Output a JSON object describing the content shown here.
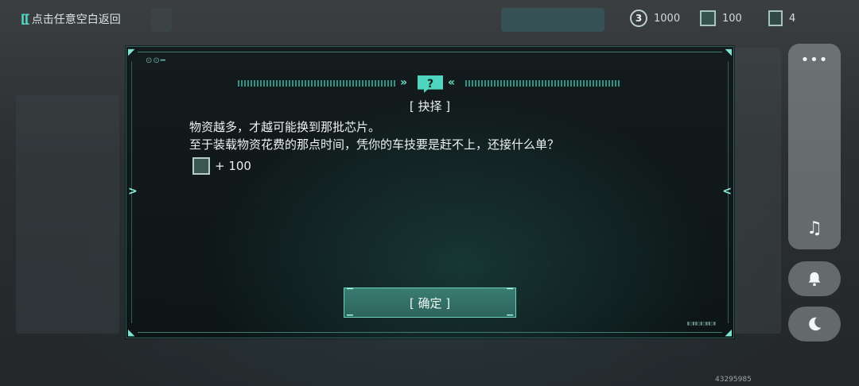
{
  "top_bar": {
    "back_label": "点击任意空白返回",
    "resources": [
      {
        "icon": "coin-icon",
        "value": "1000"
      },
      {
        "icon": "chip-icon",
        "value": "100"
      },
      {
        "icon": "token-icon",
        "value": "4"
      }
    ]
  },
  "dialog": {
    "badge": "?",
    "title": "[ 抉择 ]",
    "lines": [
      "物资越多，才越可能换到那批芯片。",
      "至于装载物资花费的那点时间，凭你的车技要是赶不上，还接什么单？"
    ],
    "reward": {
      "icon": "chip-icon",
      "text": "+ 100"
    },
    "confirm_label": "[ 确定 ]"
  },
  "side_panel": {
    "more_icon": "more-icon",
    "music_icon": "music-off-icon",
    "bell_icon": "bell-icon",
    "moon_icon": "moon-icon"
  },
  "uid": "43295985",
  "colors": {
    "accent": "#4fd6c0",
    "panel_border": "#2f5e58",
    "button": "#2c645c"
  }
}
